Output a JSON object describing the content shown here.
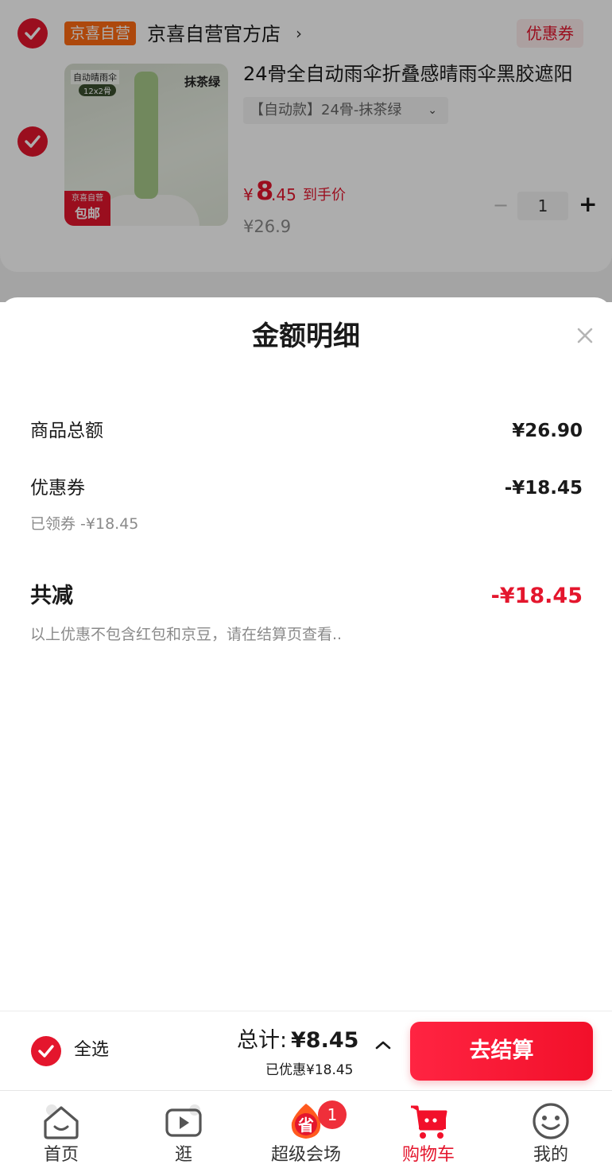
{
  "cart": {
    "shop": {
      "tag": "京喜自营",
      "name": "京喜自营官方店",
      "chevron_icon": "chevron-right-icon",
      "coupon_label": "优惠券"
    },
    "product": {
      "image_label_top_left": "自动晴雨伞",
      "image_label_pill": "12x2骨",
      "image_label_color": "抹茶绿",
      "image_badge_line1": "京喜自营",
      "image_badge_line2": "包邮",
      "title": "24骨全自动雨伞折叠感晴雨伞黑胶遮阳",
      "sku": "【自动款】24骨-抹茶绿",
      "price_currency": "¥",
      "price_integer": "8",
      "price_decimal": ".45",
      "price_label": "到手价",
      "original_price": "¥26.9",
      "quantity": "1",
      "minus_symbol": "−",
      "plus_symbol": "+"
    }
  },
  "sheet": {
    "title": "金额明细",
    "rows": [
      {
        "label": "商品总额",
        "value": "¥26.90"
      },
      {
        "label": "优惠券",
        "value": "-¥18.45",
        "note": "已领券 -¥18.45"
      }
    ],
    "total": {
      "label": "共减",
      "value": "-¥18.45"
    },
    "disclaimer": "以上优惠不包含红包和京豆，请在结算页查看.."
  },
  "checkout": {
    "select_all_label": "全选",
    "sum_label": "总计:",
    "sum_value": "¥8.45",
    "saved_note": "已优惠¥18.45",
    "button_label": "去结算"
  },
  "tab_bar": {
    "tabs": [
      {
        "label": "首页",
        "icon": "home-icon",
        "active": false
      },
      {
        "label": "逛",
        "icon": "video-play-icon",
        "active": false
      },
      {
        "label": "超级会场",
        "icon": "savings-flame-icon",
        "active": false,
        "badge": "1"
      },
      {
        "label": "购物车",
        "icon": "shopping-cart-icon",
        "active": true
      },
      {
        "label": "我的",
        "icon": "smiley-face-icon",
        "active": false
      }
    ]
  },
  "colors": {
    "accent_red": "#e4162d",
    "shop_tag_orange": "#ff6a13",
    "muted_text": "#8a8a8a"
  }
}
